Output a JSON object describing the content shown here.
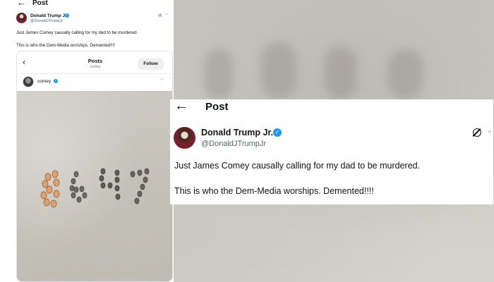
{
  "left_screenshot": {
    "header": {
      "back_icon": "arrow-left-icon",
      "title": "Post"
    },
    "tweet": {
      "author_name": "Donald Trump Jr.",
      "verified_icon": "verified-badge-icon",
      "handle": "@DonaldJTrumpJr",
      "text_line1": "Just James Comey causally calling for my dad to be murdered.",
      "text_line2": "This is who the Dem-Media worships. Demented!!!!"
    },
    "embedded_post": {
      "title": "Posts",
      "subtitle": "comey",
      "follow_label": "Follow",
      "username": "comey",
      "photo_shell_digits": "8647"
    }
  },
  "zoomed_tweet": {
    "header": {
      "back_icon": "arrow-left-icon",
      "title": "Post"
    },
    "author_name": "Donald Trump Jr.",
    "verified_icon": "verified-badge-icon",
    "handle": "@DonaldJTrumpJr",
    "grok_icon": "grok-icon",
    "more_icon": "more-icon",
    "text_line1": "Just James Comey causally calling for my dad to be murdered.",
    "text_line2": "This is who the Dem-Media worships. Demented!!!!"
  },
  "colors": {
    "verified_blue": "#1d9bf0",
    "text_primary": "#0f1419",
    "text_secondary": "#536471"
  }
}
